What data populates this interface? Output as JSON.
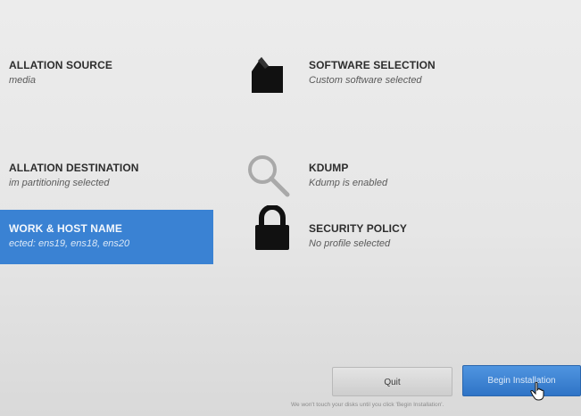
{
  "spokes": {
    "installation_source": {
      "title": "ALLATION SOURCE",
      "status": "media"
    },
    "installation_destination": {
      "title": "ALLATION DESTINATION",
      "status": "im partitioning selected"
    },
    "network_hostname": {
      "title": "WORK & HOST NAME",
      "status": "ected: ens19, ens18, ens20"
    },
    "software_selection": {
      "title": "SOFTWARE SELECTION",
      "status": "Custom software selected"
    },
    "kdump": {
      "title": "KDUMP",
      "status": "Kdump is enabled"
    },
    "security_policy": {
      "title": "SECURITY POLICY",
      "status": "No profile selected"
    }
  },
  "icons": {
    "software": "package-icon",
    "kdump": "magnifier-icon",
    "security": "padlock-icon",
    "cursor": "mouse-cursor-icon"
  },
  "buttons": {
    "quit": "Quit",
    "begin": "Begin Installation"
  },
  "footer": {
    "note": "We won't touch your disks until you click 'Begin Installation'."
  },
  "colors": {
    "selected_spoke": "#3a82d3",
    "primary_button": "#3479cc",
    "background": "#e8e8e8"
  }
}
